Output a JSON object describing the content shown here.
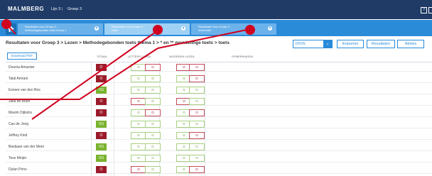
{
  "header": {
    "logo": "MALMBERG",
    "breadcrumb_lijn": "Lijn 3",
    "breadcrumb_sep": "|",
    "breadcrumb_groep": "Groep 3",
    "help_label": "?"
  },
  "tabs": [
    {
      "line1": "Resultaten voor Groep 3 -",
      "line2": "Methodegebonden toets thema 1",
      "close": "×"
    },
    {
      "line1": "Resultaten voor Groep 3 -",
      "line2": "toets",
      "close": "×"
    },
    {
      "line1": "Resultaten voor Groep 3 -",
      "line2": "observatie",
      "close": "×"
    }
  ],
  "page": {
    "title": "Resultaten voor Groep 3 > Lezen > Methodegebonden toets thema 1 > * en ** mondelinge toets > toets",
    "select_value": "D/V/G",
    "select_arrow": "⌄",
    "buttons": {
      "instoeren": "Instoeren",
      "resultaten": "Resultaten",
      "advies": "Advies"
    }
  },
  "table": {
    "download_label": "Download PDF",
    "headers": {
      "totaal": "TOTAAL",
      "letters": "LETTERS LEZEN",
      "woorden": "WOORDEN LEZEN",
      "opmerkingen": "OPMERKINGEN"
    },
    "rows": [
      {
        "name": "Dounia Amazian",
        "total": "O",
        "c": [
          "G",
          "O",
          "O",
          "O"
        ]
      },
      {
        "name": "Talal Amrani",
        "total": "O",
        "c": [
          "G",
          "G",
          "G",
          "O"
        ]
      },
      {
        "name": "Esmee van den Bos",
        "total": "VG",
        "c": [
          "G",
          "G",
          "G",
          "G"
        ]
      },
      {
        "name": "Julia de Bruin",
        "total": "O",
        "c": [
          "O",
          "G",
          "O",
          "G"
        ]
      },
      {
        "name": "Maxim Dijkstra",
        "total": "O",
        "c": [
          "G",
          "O",
          "G",
          "O"
        ]
      },
      {
        "name": "Cas de Jong",
        "total": "VG",
        "c": [
          "G",
          "G",
          "G",
          "G"
        ]
      },
      {
        "name": "Jeffrey Kind",
        "total": "O",
        "c": [
          "G",
          "G",
          "G",
          "O"
        ]
      },
      {
        "name": "Bastiaan van der Meer",
        "total": "VG",
        "c": [
          "G",
          "G",
          "G",
          "G"
        ]
      },
      {
        "name": "Tess Meijer",
        "total": "VG",
        "c": [
          "G",
          "G",
          "G",
          "G"
        ]
      },
      {
        "name": "Dylan Prins",
        "total": "O",
        "c": [
          "O",
          "G",
          "G",
          "O"
        ]
      }
    ]
  },
  "colors": {
    "header_bg": "#1f3b66",
    "tabbar_bg": "#2a8bd9",
    "tab_bg": "#6cb2ea",
    "status_o": "#9b1b2a",
    "status_vg": "#7ab32e",
    "annotation_red": "#d0001f"
  },
  "icons": {
    "home": "home-icon",
    "close": "close-icon",
    "help": "help-icon",
    "chevron": "chevron-down-icon"
  }
}
